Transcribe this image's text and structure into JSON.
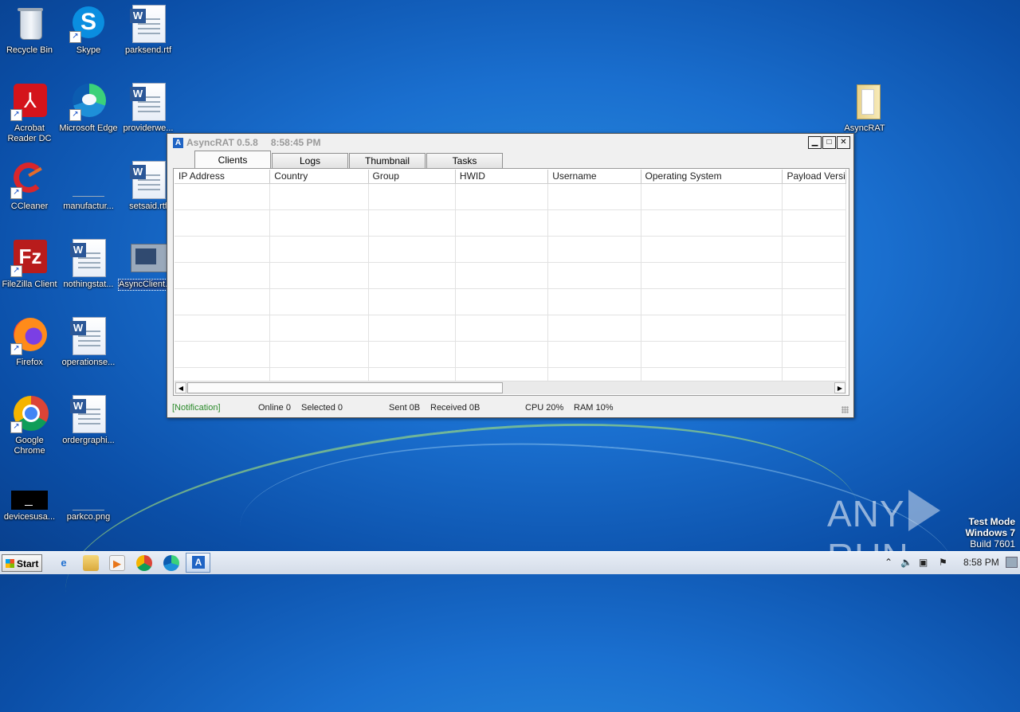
{
  "desktop": {
    "icons": [
      {
        "label": "Recycle Bin"
      },
      {
        "label": "Skype"
      },
      {
        "label": "parksend.rtf"
      },
      {
        "label": "Acrobat Reader DC"
      },
      {
        "label": "Microsoft Edge"
      },
      {
        "label": "providerwe..."
      },
      {
        "label": "CCleaner"
      },
      {
        "label": "manufactur..."
      },
      {
        "label": "setsaid.rtf"
      },
      {
        "label": "FileZilla Client"
      },
      {
        "label": "nothingstat..."
      },
      {
        "label": "AsyncClient.exe"
      },
      {
        "label": "Firefox"
      },
      {
        "label": "operationse..."
      },
      {
        "label": "Google Chrome"
      },
      {
        "label": "ordergraphi..."
      },
      {
        "label": "devicesusa..."
      },
      {
        "label": "parkco.png"
      },
      {
        "label": "AsyncRAT"
      }
    ]
  },
  "window": {
    "title": "AsyncRAT 0.5.8",
    "time": "8:58:45 PM",
    "app_icon_glyph": "A",
    "tabs": [
      "Clients",
      "Logs",
      "Thumbnail",
      "Tasks"
    ],
    "columns": [
      "IP Address",
      "Country",
      "Group",
      "HWID",
      "Username",
      "Operating System",
      "Payload Versio"
    ],
    "status": {
      "notification": "[Notification]",
      "online": "Online 0",
      "selected": "Selected 0",
      "sent": "Sent 0B",
      "received": "Received 0B",
      "cpu": "CPU 20%",
      "ram": "RAM 10%"
    }
  },
  "taskbar": {
    "start": "Start",
    "clock": "8:58 PM"
  },
  "watermark": {
    "brand_left": "ANY",
    "brand_right": "RUN",
    "line1": "Test Mode",
    "line2": "Windows 7",
    "line3": "Build 7601"
  },
  "colors": {
    "notification": "#2a8a2a",
    "desktop_bg": "#1a6fcf",
    "selection": "#1f4fa0"
  }
}
